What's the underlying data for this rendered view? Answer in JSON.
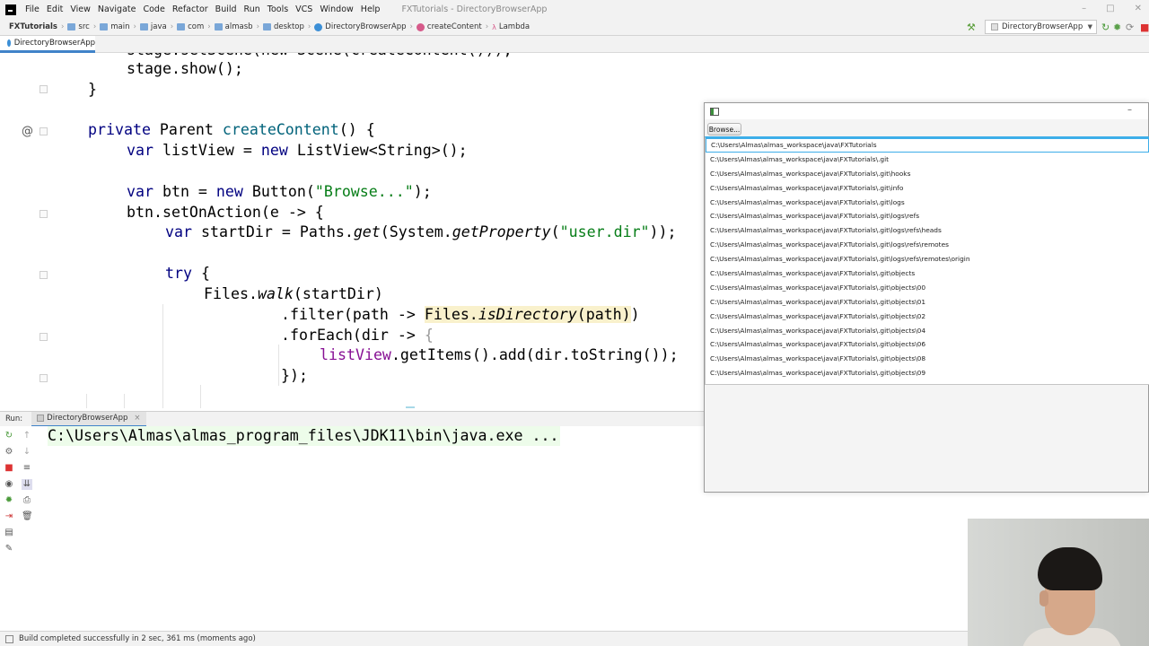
{
  "menubar": {
    "items": [
      "File",
      "Edit",
      "View",
      "Navigate",
      "Code",
      "Refactor",
      "Build",
      "Run",
      "Tools",
      "VCS",
      "Window",
      "Help"
    ],
    "title": "FXTutorials - DirectoryBrowserApp"
  },
  "breadcrumb": {
    "project": "FXTutorials",
    "parts": [
      "src",
      "main",
      "java",
      "com",
      "almasb",
      "desktop"
    ],
    "class": "DirectoryBrowserApp",
    "method": "createContent",
    "lambda": "Lambda"
  },
  "toolbar": {
    "run_config": "DirectoryBrowserApp"
  },
  "editor": {
    "tab": "DirectoryBrowserApp",
    "lines": {
      "l0": "stage.setScene(new Scene(createContent()));",
      "l1": "stage.show();",
      "l2": "}",
      "l4_kw": "private",
      "l4_rest": " Parent ",
      "l4_name": "createContent",
      "l4_end": "() {",
      "l5_kw": "var",
      "l5_mid": " listView = ",
      "l5_new": "new",
      "l5_end": " ListView<String>();",
      "l7_kw": "var",
      "l7_mid": " btn = ",
      "l7_new": "new",
      "l7_a": " Button(",
      "l7_str": "\"Browse...\"",
      "l7_end": ");",
      "l8": "btn.setOnAction(e -> {",
      "l9_kw": "var",
      "l9_a": " startDir = Paths.",
      "l9_get": "get",
      "l9_b": "(System.",
      "l9_prop": "getProperty",
      "l9_c": "(",
      "l9_str": "\"user.dir\"",
      "l9_end": "));",
      "l11_kw": "try",
      "l11_end": " {",
      "l12_a": "Files.",
      "l12_walk": "walk",
      "l12_end": "(startDir)",
      "l13_a": ".filter(path -> ",
      "l13_hl1": "Files.",
      "l13_hl2": "isDirectory",
      "l13_hl3": "(path)",
      "l13_end": ")",
      "l14_a": ".forEach(dir -> ",
      "l14_brace": "{",
      "l15_lv": "listView",
      "l15_end": ".getItems().add(dir.toString());",
      "l16": "});"
    },
    "annotation_marker": "@"
  },
  "run": {
    "label": "Run:",
    "tab": "DirectoryBrowserApp",
    "console": "C:\\Users\\Almas\\almas_program_files\\JDK11\\bin\\java.exe ..."
  },
  "status": {
    "message": "Build completed successfully in 2 sec, 361 ms (moments ago)"
  },
  "fxapp": {
    "browse_label": "Browse...",
    "items": [
      "C:\\Users\\Almas\\almas_workspace\\java\\FXTutorials",
      "C:\\Users\\Almas\\almas_workspace\\java\\FXTutorials\\.git",
      "C:\\Users\\Almas\\almas_workspace\\java\\FXTutorials\\.git\\hooks",
      "C:\\Users\\Almas\\almas_workspace\\java\\FXTutorials\\.git\\info",
      "C:\\Users\\Almas\\almas_workspace\\java\\FXTutorials\\.git\\logs",
      "C:\\Users\\Almas\\almas_workspace\\java\\FXTutorials\\.git\\logs\\refs",
      "C:\\Users\\Almas\\almas_workspace\\java\\FXTutorials\\.git\\logs\\refs\\heads",
      "C:\\Users\\Almas\\almas_workspace\\java\\FXTutorials\\.git\\logs\\refs\\remotes",
      "C:\\Users\\Almas\\almas_workspace\\java\\FXTutorials\\.git\\logs\\refs\\remotes\\origin",
      "C:\\Users\\Almas\\almas_workspace\\java\\FXTutorials\\.git\\objects",
      "C:\\Users\\Almas\\almas_workspace\\java\\FXTutorials\\.git\\objects\\00",
      "C:\\Users\\Almas\\almas_workspace\\java\\FXTutorials\\.git\\objects\\01",
      "C:\\Users\\Almas\\almas_workspace\\java\\FXTutorials\\.git\\objects\\02",
      "C:\\Users\\Almas\\almas_workspace\\java\\FXTutorials\\.git\\objects\\04",
      "C:\\Users\\Almas\\almas_workspace\\java\\FXTutorials\\.git\\objects\\06",
      "C:\\Users\\Almas\\almas_workspace\\java\\FXTutorials\\.git\\objects\\08",
      "C:\\Users\\Almas\\almas_workspace\\java\\FXTutorials\\.git\\objects\\09"
    ]
  },
  "colors": {
    "keyword": "#000080",
    "string": "#067d17",
    "accent": "#3daee9",
    "highlight": "#f9f1cc"
  }
}
